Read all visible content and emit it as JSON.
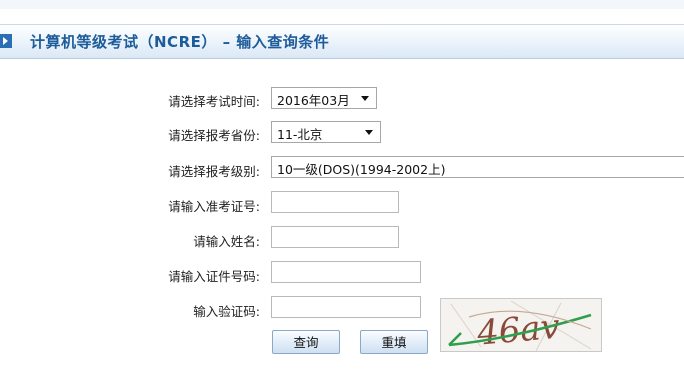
{
  "header": {
    "title": "计算机等级考试（NCRE） – 输入查询条件"
  },
  "form": {
    "exam_time": {
      "label": "请选择考试时间:",
      "value": "2016年03月"
    },
    "province": {
      "label": "请选择报考省份:",
      "value": "11-北京"
    },
    "level": {
      "label": "请选择报考级别:",
      "value": "10一级(DOS)(1994-2002上)"
    },
    "ticket_no": {
      "label": "请输入准考证号:",
      "value": ""
    },
    "name": {
      "label": "请输入姓名:",
      "value": ""
    },
    "id_no": {
      "label": "请输入证件号码:",
      "value": ""
    },
    "captcha": {
      "label": "输入验证码:",
      "value": "",
      "image_text": "46av"
    }
  },
  "buttons": {
    "query": "查询",
    "reset": "重填"
  },
  "colors": {
    "title": "#1d5b9a",
    "accent": "#2a6fb5",
    "captcha_line": "#2f9e4d",
    "captcha_text": "#8a4a3a"
  }
}
